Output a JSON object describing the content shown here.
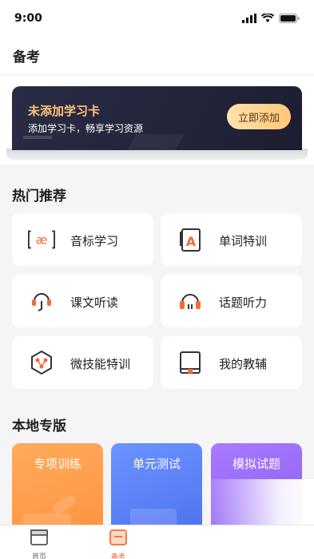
{
  "status_bar": {
    "time": "9:00"
  },
  "header": {
    "title": "备考"
  },
  "banner": {
    "title": "未添加学习卡",
    "subtitle": "添加学习卡，畅享学习资源",
    "button_label": "立即添加"
  },
  "hot": {
    "section_title": "热门推荐",
    "items": [
      {
        "label": "音标学习",
        "icon": "phonetic-icon"
      },
      {
        "label": "单词特训",
        "icon": "vocabulary-icon"
      },
      {
        "label": "课文听读",
        "icon": "listen-read-icon"
      },
      {
        "label": "话题听力",
        "icon": "headphones-icon"
      },
      {
        "label": "微技能特训",
        "icon": "skill-icon"
      },
      {
        "label": "我的教辅",
        "icon": "book-icon"
      }
    ]
  },
  "local": {
    "section_title": "本地专版",
    "tiles": [
      {
        "label": "专项训练",
        "color": "#ffa24f"
      },
      {
        "label": "单元测试",
        "color": "#5f86f9"
      },
      {
        "label": "模拟试题",
        "color": "#9a6cf8"
      }
    ]
  },
  "tabbar": {
    "tabs": [
      {
        "label": "首页",
        "icon": "home-icon",
        "active": false
      },
      {
        "label": "备考",
        "icon": "exam-prep-icon",
        "active": true
      }
    ]
  },
  "colors": {
    "accent": "#f26b3a",
    "banner_title": "#ffc37a"
  }
}
